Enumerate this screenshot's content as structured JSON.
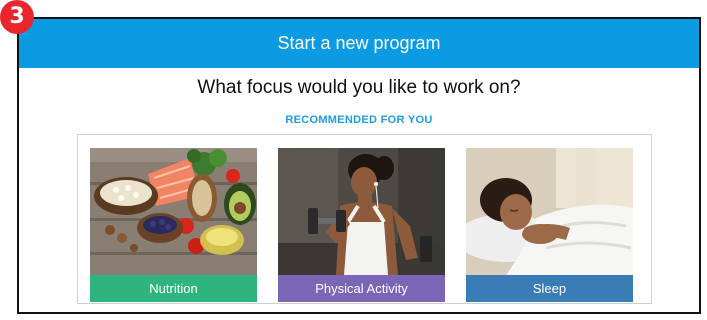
{
  "step": {
    "number": "3",
    "color": "#e8262e"
  },
  "header": {
    "title": "Start a new program",
    "color": "#0a9be3"
  },
  "prompt": {
    "question": "What focus would you like to work on?"
  },
  "recommendation": {
    "heading": "RECOMMENDED FOR YOU"
  },
  "cards": [
    {
      "label": "Nutrition",
      "color": "#2eb57f",
      "icon": "healthy-food-photo"
    },
    {
      "label": "Physical Activity",
      "color": "#7a66b7",
      "icon": "dumbbell-workout-photo"
    },
    {
      "label": "Sleep",
      "color": "#3a7cb6",
      "icon": "sleeping-woman-photo"
    }
  ]
}
